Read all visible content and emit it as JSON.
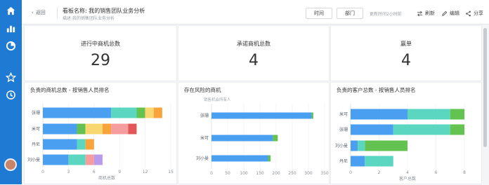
{
  "header": {
    "back_label": "返回",
    "title": "看板名称: 我的销售团队业务分析",
    "subtitle": "描述:我的销售团队业务分析",
    "time_button": "时间",
    "dept_button": "部门",
    "updated_text": "更新时间2小时前",
    "refresh_label": "刷新",
    "edit_label": "编辑",
    "share_label": "分享"
  },
  "kpis": [
    {
      "label": "进行中商机总数",
      "value": "29"
    },
    {
      "label": "承诺商机总数",
      "value": "4"
    },
    {
      "label": "赢单",
      "value": "4"
    }
  ],
  "colors": {
    "rail": "#1e7ad3",
    "blue": "#4b9ff0",
    "teal": "#5bd6c0",
    "green": "#64c350",
    "yellow": "#f9d76e",
    "orange": "#f8a33c",
    "pink": "#f59d9d",
    "red": "#e45757",
    "purple": "#b89bea"
  },
  "chart_data": [
    {
      "type": "bar",
      "orientation": "horizontal",
      "stacked": true,
      "title": "负责的商机总数 - 按销售人员排名",
      "categories": [
        "张珊",
        "米可",
        "丹尼",
        "刘小曼"
      ],
      "series": [
        {
          "color": "#4b9ff0",
          "values": [
            8,
            4,
            4,
            3
          ]
        },
        {
          "color": "#5bd6c0",
          "values": [
            3,
            0,
            1,
            2
          ]
        },
        {
          "color": "#64c350",
          "values": [
            1,
            1,
            0,
            0
          ]
        },
        {
          "color": "#f9d76e",
          "values": [
            1,
            2,
            0,
            0
          ]
        },
        {
          "color": "#f8a33c",
          "values": [
            1,
            1,
            1,
            0
          ]
        },
        {
          "color": "#f59d9d",
          "values": [
            0,
            2,
            0,
            1
          ]
        },
        {
          "color": "#e45757",
          "values": [
            0,
            1,
            0,
            0
          ]
        },
        {
          "color": "#b89bea",
          "values": [
            0,
            0,
            0,
            1
          ]
        }
      ],
      "xlim": [
        0,
        15
      ],
      "xticks": [
        0,
        3,
        6,
        9,
        12,
        15
      ],
      "xlabel": "商机总数"
    },
    {
      "type": "bar",
      "orientation": "horizontal",
      "stacked": true,
      "title": "存在风险的商机",
      "subtitle": "销售机会所有人",
      "categories": [
        "张珊",
        "米可",
        "刘小曼"
      ],
      "series": [
        {
          "color": "#4b9ff0",
          "values": [
            310,
            190,
            175
          ]
        },
        {
          "color": "#64c350",
          "values": [
            5,
            15,
            8
          ]
        }
      ],
      "xlim": [
        0,
        350
      ],
      "xticks": [
        0,
        50,
        100,
        150,
        200,
        250,
        300,
        350
      ]
    },
    {
      "type": "bar",
      "orientation": "horizontal",
      "stacked": true,
      "title": "负责的客户总数 - 按销售人员排名",
      "categories": [
        "米可",
        "张珊",
        "刘小曼",
        "丹尼"
      ],
      "series": [
        {
          "color": "#4b9ff0",
          "values": [
            4,
            3,
            0.5,
            1
          ]
        },
        {
          "color": "#5bd6c0",
          "values": [
            3,
            4,
            0.5,
            2
          ]
        },
        {
          "color": "#64c350",
          "values": [
            1,
            1,
            3,
            0
          ]
        }
      ],
      "xlim": [
        0,
        8
      ],
      "xticks": [
        0,
        2,
        4,
        6,
        8
      ],
      "xlabel": "客户总数"
    }
  ]
}
